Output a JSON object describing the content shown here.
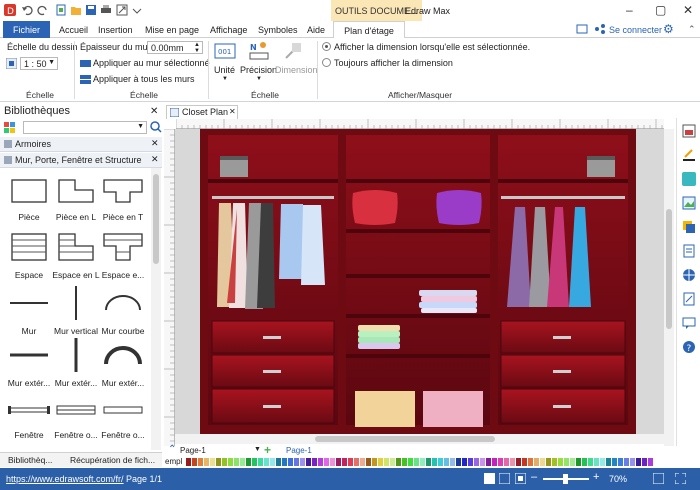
{
  "app": {
    "contextual_tab": "OUTILS DOCUME...",
    "title": "Edraw Max"
  },
  "ribbon_tabs": [
    "Fichier",
    "Accueil",
    "Insertion",
    "Mise en page",
    "Affichage",
    "Symboles",
    "Aide",
    "Plan d'étage"
  ],
  "header_right": {
    "connect": "Se connecter"
  },
  "ribbon": {
    "echelle_dessin_label": "Échelle du dessin",
    "echelle_value": "1 : 50",
    "epaisseur_label": "Épaisseur du mur:",
    "epaisseur_value": "0.00mm",
    "apply_selected": "Appliquer au mur sélectionné",
    "apply_all": "Appliquer à tous les murs",
    "group_echelle_1": "Échelle",
    "group_echelle_2": "Échelle",
    "group_echelle_3": "Échelle",
    "unite": "Unité",
    "precision": "Précision",
    "dimension": "Dimension",
    "radio_selected": "Afficher la dimension lorsqu'elle est sélectionnée.",
    "radio_always": "Toujours afficher la dimension",
    "group_afficher": "Afficher/Masquer"
  },
  "library": {
    "title": "Bibliothèques",
    "cat1": "Armoires",
    "cat2": "Mur, Porte, Fenêtre et Structure",
    "shapes": [
      "Pièce",
      "Pièce en L",
      "Pièce en T",
      "Espace",
      "Espace en L",
      "Espace e...",
      "Mur",
      "Mur vertical",
      "Mur courbe",
      "Mur extér...",
      "Mur extér...",
      "Mur extér...",
      "Fenêtre",
      "Fenêtre o...",
      "Fenêtre o..."
    ],
    "tab_libs": "Bibliothèq...",
    "tab_recovery": "Récupération de fich..."
  },
  "document_tab": "Closet Plan",
  "page_bar": {
    "page_dropdown": "Page-1",
    "page_tab": "Page-1"
  },
  "palette_label": "empl",
  "status": {
    "url": "https://www.edrawsoft.com/fr/",
    "page": "Page 1/1",
    "zoom": "70%"
  },
  "colors": {
    "accent": "#2b64b5",
    "contextual": "#fbe7b6",
    "closet": "#7a0a12",
    "status": "#2b5fa8"
  }
}
